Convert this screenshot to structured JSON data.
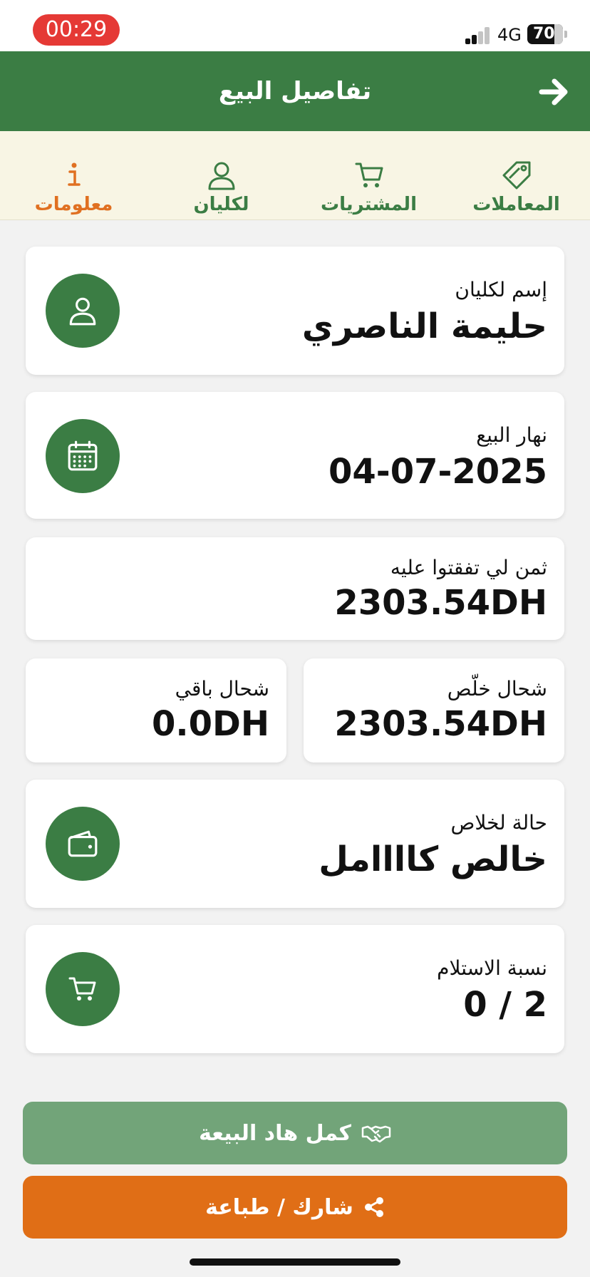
{
  "status_bar": {
    "time": "00:29",
    "network": "4G",
    "battery": "70"
  },
  "header": {
    "title": "تفاصيل البيع",
    "back_icon": "arrow-right-icon"
  },
  "tabs": [
    {
      "label": "المعاملات",
      "icon": "tag-icon",
      "active": false
    },
    {
      "label": "المشتريات",
      "icon": "cart-icon",
      "active": false
    },
    {
      "label": "لكليان",
      "icon": "user-icon",
      "active": false
    },
    {
      "label": "معلومات",
      "icon": "info-icon",
      "active": true
    }
  ],
  "cards": {
    "client": {
      "label": "إسم لكليان",
      "value": "حليمة الناصري",
      "icon": "user-icon"
    },
    "date": {
      "label": "نهار البيع",
      "value": "04-07-2025",
      "icon": "calendar-icon"
    },
    "agreed_price": {
      "label": "ثمن لي تفقتوا عليه",
      "value": "2303.54DH"
    },
    "paid": {
      "label": "شحال خلّص",
      "value": "2303.54DH"
    },
    "remaining": {
      "label": "شحال باقي",
      "value": "0.0DH"
    },
    "payment_status": {
      "label": "حالة لخلاص",
      "value": "خالص كاااامل",
      "icon": "wallet-icon"
    },
    "receipt_ratio": {
      "label": "نسبة الاستلام",
      "value": "0 / 2",
      "icon": "cart-icon"
    }
  },
  "buttons": {
    "complete": {
      "label": "كمل هاد البيعة",
      "icon": "handshake-icon"
    },
    "share": {
      "label": "شارك / طباعة",
      "icon": "share-icon"
    }
  },
  "colors": {
    "primary_green": "#3b7d44",
    "accent_orange": "#e07021",
    "tab_bg": "#f8f5e4",
    "muted_green": "#72a479"
  }
}
